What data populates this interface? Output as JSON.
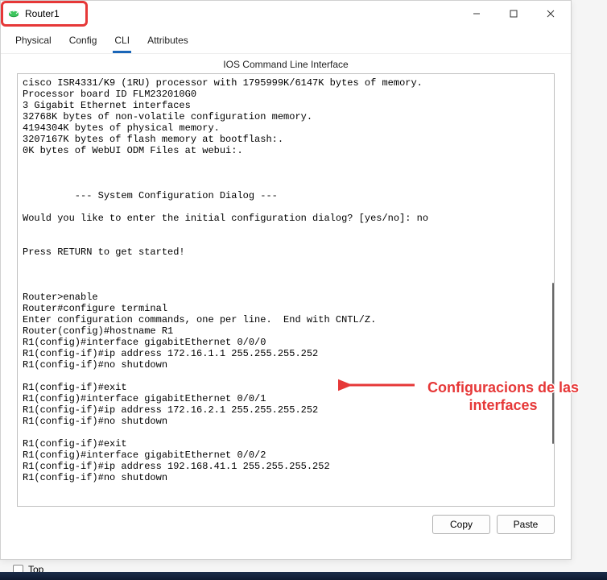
{
  "window": {
    "title": "Router1"
  },
  "tabs": {
    "physical": "Physical",
    "config": "Config",
    "cli": "CLI",
    "attributes": "Attributes"
  },
  "subheader": "IOS Command Line Interface",
  "terminal_text": "cisco ISR4331/K9 (1RU) processor with 1795999K/6147K bytes of memory.\nProcessor board ID FLM232010G0\n3 Gigabit Ethernet interfaces\n32768K bytes of non-volatile configuration memory.\n4194304K bytes of physical memory.\n3207167K bytes of flash memory at bootflash:.\n0K bytes of WebUI ODM Files at webui:.\n\n\n\n         --- System Configuration Dialog ---\n\nWould you like to enter the initial configuration dialog? [yes/no]: no\n\n\nPress RETURN to get started!\n\n\n\nRouter>enable\nRouter#configure terminal\nEnter configuration commands, one per line.  End with CNTL/Z.\nRouter(config)#hostname R1\nR1(config)#interface gigabitEthernet 0/0/0\nR1(config-if)#ip address 172.16.1.1 255.255.255.252\nR1(config-if)#no shutdown\n\nR1(config-if)#exit\nR1(config)#interface gigabitEthernet 0/0/1\nR1(config-if)#ip address 172.16.2.1 255.255.255.252\nR1(config-if)#no shutdown\n\nR1(config-if)#exit\nR1(config)#interface gigabitEthernet 0/0/2\nR1(config-if)#ip address 192.168.41.1 255.255.255.252\nR1(config-if)#no shutdown",
  "buttons": {
    "copy": "Copy",
    "paste": "Paste"
  },
  "footer": {
    "top_label": "Top"
  },
  "annotation": {
    "text": "Configuracions de las interfaces"
  }
}
